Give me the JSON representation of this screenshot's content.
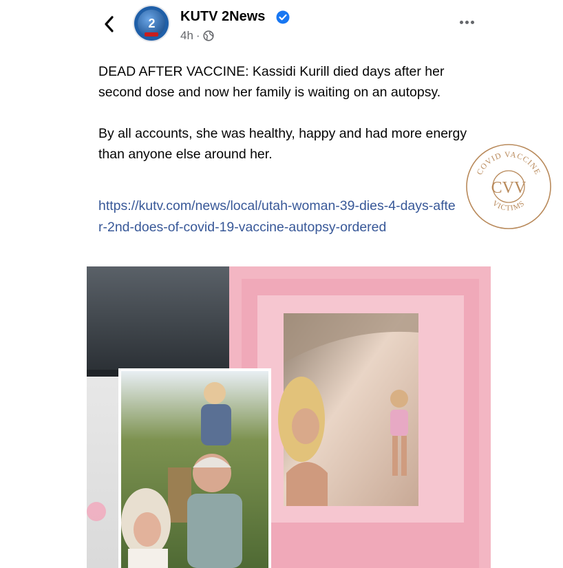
{
  "header": {
    "page_name": "KUTV 2News",
    "time": "4h",
    "separator": "·",
    "avatar_text": "2"
  },
  "post": {
    "paragraph1": "DEAD AFTER VACCINE: Kassidi Kurill died days after her second dose and now her family is waiting on an autopsy.",
    "paragraph2": "By all accounts, she was healthy, happy and had more energy than anyone else around her.",
    "link": "https://kutv.com/news/local/utah-woman-39-dies-4-days-after-2nd-does-of-covid-19-vaccine-autopsy-ordered"
  },
  "stamp": {
    "top_text": "COVID VACCINE",
    "center_text": "CVV",
    "bottom_text": "VICTIMS"
  },
  "colors": {
    "link": "#385898",
    "verified": "#1877f2",
    "stamp": "#b8895a",
    "frame": "#f3b6c3"
  },
  "icons": {
    "back": "chevron-left-icon",
    "verified": "verified-badge-icon",
    "audience": "globe-icon",
    "more": "more-horizontal-icon"
  }
}
